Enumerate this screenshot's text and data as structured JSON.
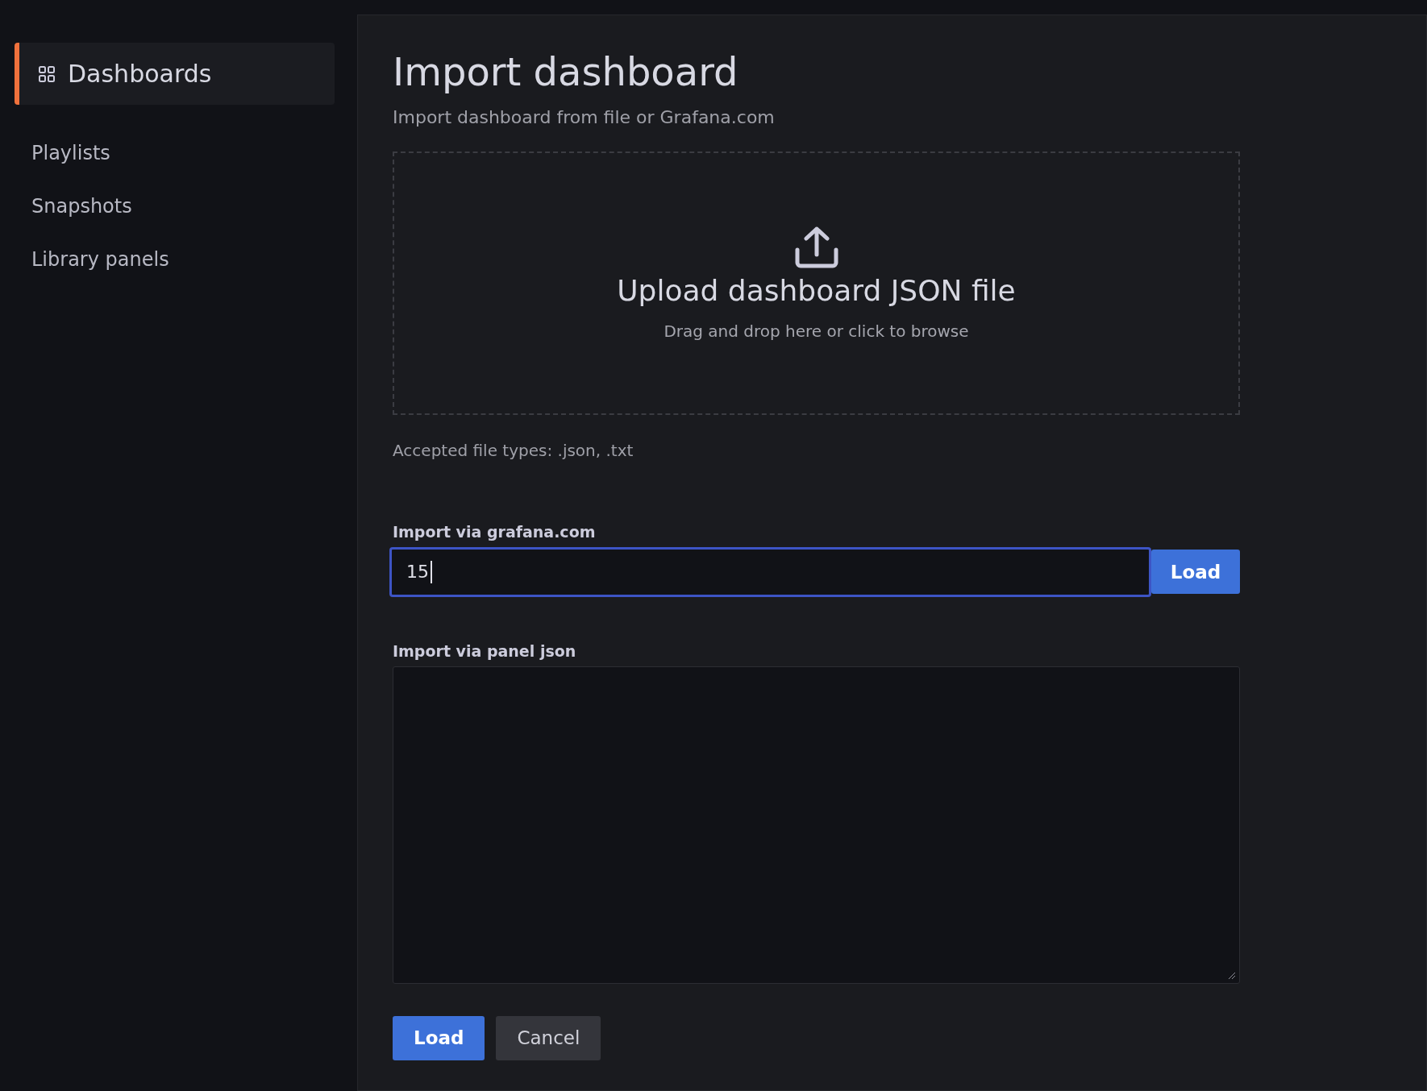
{
  "sidebar": {
    "items": [
      {
        "label": "Dashboards",
        "selected": true,
        "kind": "header"
      },
      {
        "label": "Playlists",
        "selected": false,
        "kind": "link"
      },
      {
        "label": "Snapshots",
        "selected": false,
        "kind": "link"
      },
      {
        "label": "Library panels",
        "selected": false,
        "kind": "link"
      }
    ]
  },
  "page": {
    "title": "Import dashboard",
    "subtitle": "Import dashboard from file or Grafana.com"
  },
  "upload": {
    "title": "Upload dashboard JSON file",
    "hint": "Drag and drop here or click to browse",
    "accepted": "Accepted file types: .json, .txt"
  },
  "grafana_import": {
    "label": "Import via grafana.com",
    "value": "15",
    "focused": true,
    "button": "Load"
  },
  "panel_json": {
    "label": "Import via panel json"
  },
  "buttons": [
    {
      "label": "Load",
      "kind": "primary"
    },
    {
      "label": "Cancel",
      "kind": "secondary"
    }
  ]
}
